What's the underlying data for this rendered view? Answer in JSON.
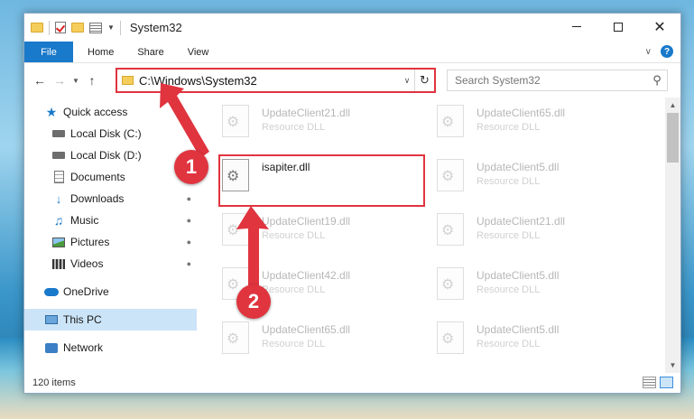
{
  "window": {
    "title": "System32"
  },
  "ribbon": {
    "tabs": [
      "File",
      "Home",
      "Share",
      "View"
    ]
  },
  "address": {
    "path": "C:\\Windows\\System32"
  },
  "search": {
    "placeholder": "Search System32"
  },
  "sidebar": {
    "items": [
      {
        "label": "Quick access",
        "icon": "star-icon",
        "pinned": false
      },
      {
        "label": "Local Disk (C:)",
        "icon": "drive-icon",
        "pinned": true
      },
      {
        "label": "Local Disk (D:)",
        "icon": "drive-icon",
        "pinned": false
      },
      {
        "label": "Documents",
        "icon": "documents-icon",
        "pinned": true
      },
      {
        "label": "Downloads",
        "icon": "download-icon",
        "pinned": true
      },
      {
        "label": "Music",
        "icon": "music-icon",
        "pinned": true
      },
      {
        "label": "Pictures",
        "icon": "pictures-icon",
        "pinned": true
      },
      {
        "label": "Videos",
        "icon": "videos-icon",
        "pinned": true
      },
      {
        "label": "OneDrive",
        "icon": "onedrive-icon",
        "pinned": false
      },
      {
        "label": "This PC",
        "icon": "this-pc-icon",
        "pinned": false,
        "selected": true
      },
      {
        "label": "Network",
        "icon": "network-icon",
        "pinned": false
      }
    ]
  },
  "files": [
    {
      "name": "UpdateClient21.dll",
      "type": "Resource DLL"
    },
    {
      "name": "UpdateClient65.dll",
      "type": "Resource DLL"
    },
    {
      "name": "isapiter.dll",
      "type": ""
    },
    {
      "name": "UpdateClient5.dll",
      "type": "Resource DLL"
    },
    {
      "name": "UpdateClient19.dll",
      "type": "Resource DLL"
    },
    {
      "name": "UpdateClient21.dll",
      "type": "Resource DLL"
    },
    {
      "name": "UpdateClient42.dll",
      "type": "Resource DLL"
    },
    {
      "name": "UpdateClient5.dll",
      "type": "Resource DLL"
    },
    {
      "name": "UpdateClient65.dll",
      "type": "Resource DLL"
    },
    {
      "name": "UpdateClient5.dll",
      "type": "Resource DLL"
    }
  ],
  "status": {
    "item_count": "120 items"
  },
  "annotations": {
    "step1": "1",
    "step2": "2"
  },
  "colors": {
    "accent": "#1979ca",
    "highlight": "#e0343f",
    "selection": "#cce4f7"
  }
}
